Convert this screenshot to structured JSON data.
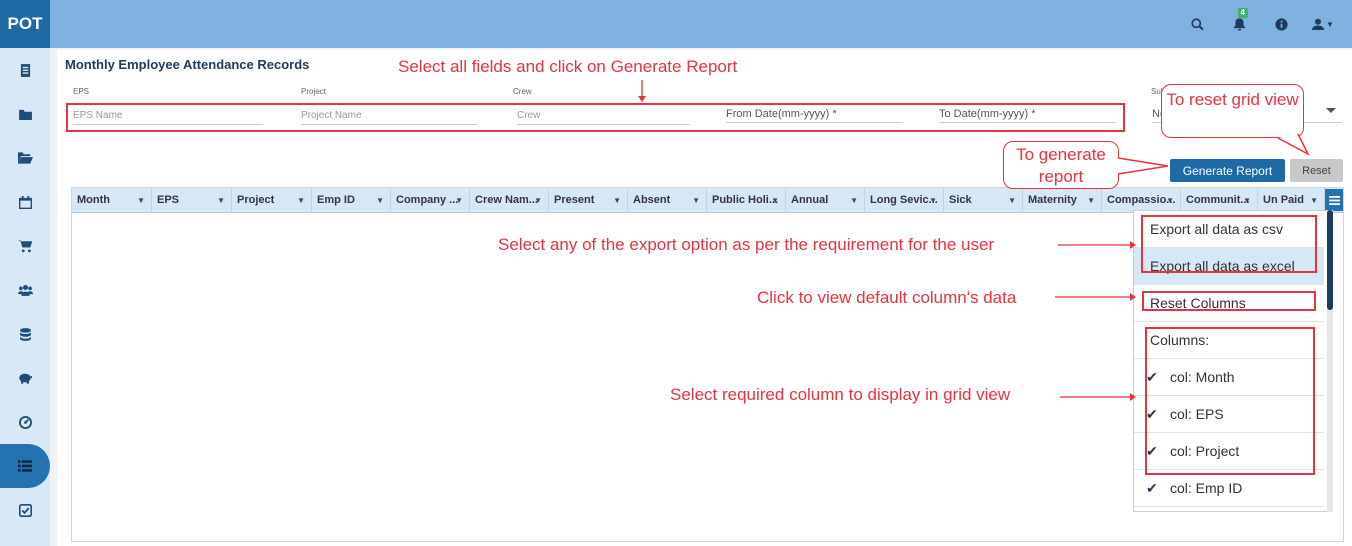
{
  "app": {
    "logo": "POT"
  },
  "topbar": {
    "notification_count": "4"
  },
  "page": {
    "title": "Monthly Employee Attendance Records"
  },
  "filters": {
    "eps_label": "EPS",
    "eps_placeholder": "EPS Name",
    "project_label": "Project",
    "project_placeholder": "Project Name",
    "crew_label": "Crew",
    "crew_placeholder": "Crew",
    "from_date": "From Date(mm-yyyy) *",
    "to_date": "To Date(mm-yyyy) *",
    "sub_reports_label": "Sub Reports",
    "sub_reports_value": "None"
  },
  "buttons": {
    "generate": "Generate Report",
    "reset": "Reset"
  },
  "grid": {
    "columns": [
      "Month",
      "EPS",
      "Project",
      "Emp ID",
      "Company ...",
      "Crew Nam...",
      "Present",
      "Absent",
      "Public Holi...",
      "Annual",
      "Long Sevic...",
      "Sick",
      "Maternity",
      "Compassio...",
      "Communit...",
      "Un Paid"
    ]
  },
  "menu": {
    "export_csv": "Export all data as csv",
    "export_excel": "Export all data as excel",
    "reset_columns": "Reset Columns",
    "columns_header": "Columns:",
    "column_items": [
      "col: Month",
      "col: EPS",
      "col: Project",
      "col: Emp ID"
    ]
  },
  "annotations": {
    "select_fields": "Select all fields and click on Generate Report",
    "reset_grid": "To reset grid view",
    "generate": "To generate report",
    "export_option": "Select any of the export option as per the requirement for the user",
    "default_columns": "Click to view default column's data",
    "select_columns": "Select required column to display in grid view"
  },
  "colors": {
    "accent": "#1f6aa5",
    "topbar": "#7fb2e0",
    "annotation": "#e8333f"
  }
}
